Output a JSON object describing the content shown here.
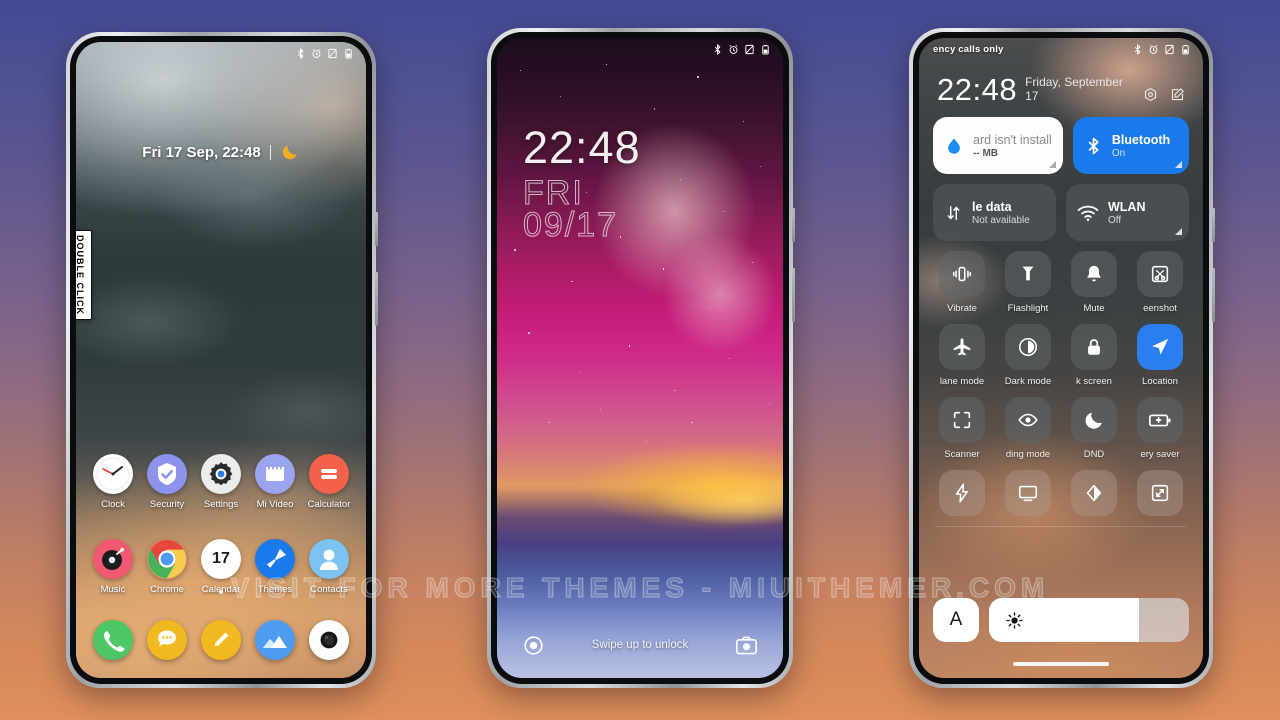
{
  "watermark": "VISIT FOR MORE THEMES - MIUITHEMER.COM",
  "background": {
    "top_color": "#434a94",
    "bottom_color": "#e08f5d"
  },
  "status_icons": [
    "bluetooth-icon",
    "alarm-icon",
    "no-sim-icon",
    "battery-icon"
  ],
  "phone1": {
    "name": "home-screen",
    "clock_text": "Fri 17 Sep, 22:48",
    "weather_icon": "moon-icon",
    "badge": "DOUBLE CLICK",
    "apps_row1": [
      {
        "label": "Clock",
        "icon": "clock-icon"
      },
      {
        "label": "Security",
        "icon": "shield-check-icon"
      },
      {
        "label": "Settings",
        "icon": "gear-icon"
      },
      {
        "label": "Mi Video",
        "icon": "video-icon"
      },
      {
        "label": "Calculator",
        "icon": "calculator-icon"
      }
    ],
    "apps_row2": [
      {
        "label": "Music",
        "icon": "vinyl-record-icon"
      },
      {
        "label": "Chrome",
        "icon": "chrome-icon"
      },
      {
        "label": "Calendar",
        "icon": "calendar-icon",
        "day": "17"
      },
      {
        "label": "Themes",
        "icon": "paint-brush-icon"
      },
      {
        "label": "Contacts",
        "icon": "person-icon"
      }
    ],
    "dock": [
      {
        "label": "Phone",
        "icon": "phone-icon",
        "color": "#4cc764"
      },
      {
        "label": "Messages",
        "icon": "message-bubble-icon",
        "color": "#f2b820"
      },
      {
        "label": "Notes",
        "icon": "pencil-icon",
        "color": "#f2b820"
      },
      {
        "label": "Gallery",
        "icon": "mountain-icon",
        "color": "#4e9cf0"
      },
      {
        "label": "Camera",
        "icon": "camera-lens-icon",
        "color": "#ffffff"
      }
    ]
  },
  "phone2": {
    "name": "lock-screen",
    "time": "22:48",
    "day": "FRI",
    "date": "09/17",
    "unlock_hint": "Swipe up to unlock",
    "left_icon": "flashlight-ring-icon",
    "right_icon": "camera-icon"
  },
  "phone3": {
    "name": "control-center",
    "carrier_text": "ency calls only",
    "time": "22:48",
    "date": "Friday, September 17",
    "header_icons": [
      "settings-hex-icon",
      "edit-icon"
    ],
    "big_tiles": [
      {
        "title": "ard isn't install",
        "sub": "-- MB",
        "icon": "storage-drop-icon",
        "style": "white"
      },
      {
        "title": "Bluetooth",
        "sub": "On",
        "icon": "bluetooth-icon",
        "style": "blue"
      },
      {
        "title": "le data",
        "sub": "Not available",
        "icon": "data-transfer-icon",
        "style": "dim"
      },
      {
        "title": "WLAN",
        "sub": "Off",
        "icon": "wifi-icon",
        "style": "dim"
      }
    ],
    "toggles": [
      {
        "label": "Vibrate",
        "icon": "vibrate-icon",
        "active": false
      },
      {
        "label": "Flashlight",
        "icon": "flashlight-icon",
        "active": false
      },
      {
        "label": "Mute",
        "icon": "bell-icon",
        "active": false
      },
      {
        "label": "eenshot",
        "icon": "screenshot-scissors-icon",
        "active": false
      },
      {
        "label": "lane mode",
        "icon": "airplane-icon",
        "active": false
      },
      {
        "label": "Dark mode",
        "icon": "contrast-circle-icon",
        "active": false
      },
      {
        "label": "k screen",
        "icon": "lock-icon",
        "active": false
      },
      {
        "label": "Location",
        "icon": "location-arrow-icon",
        "active": true
      },
      {
        "label": "Scanner",
        "icon": "scan-frame-icon",
        "active": false
      },
      {
        "label": "ding mode",
        "icon": "eye-icon",
        "active": false
      },
      {
        "label": "DND",
        "icon": "crescent-moon-icon",
        "active": false
      },
      {
        "label": "ery saver",
        "icon": "battery-plus-icon",
        "active": false
      }
    ],
    "partial_toggles": [
      {
        "label": "",
        "icon": "lightning-bolt-icon"
      },
      {
        "label": "",
        "icon": "cast-screen-icon"
      },
      {
        "label": "",
        "icon": "color-diamond-icon"
      },
      {
        "label": "",
        "icon": "fullscreen-arrows-icon"
      }
    ],
    "brightness": {
      "auto_label": "A",
      "icon": "sun-icon",
      "level_percent": 75
    },
    "accent_color": "#1a7aeb"
  }
}
